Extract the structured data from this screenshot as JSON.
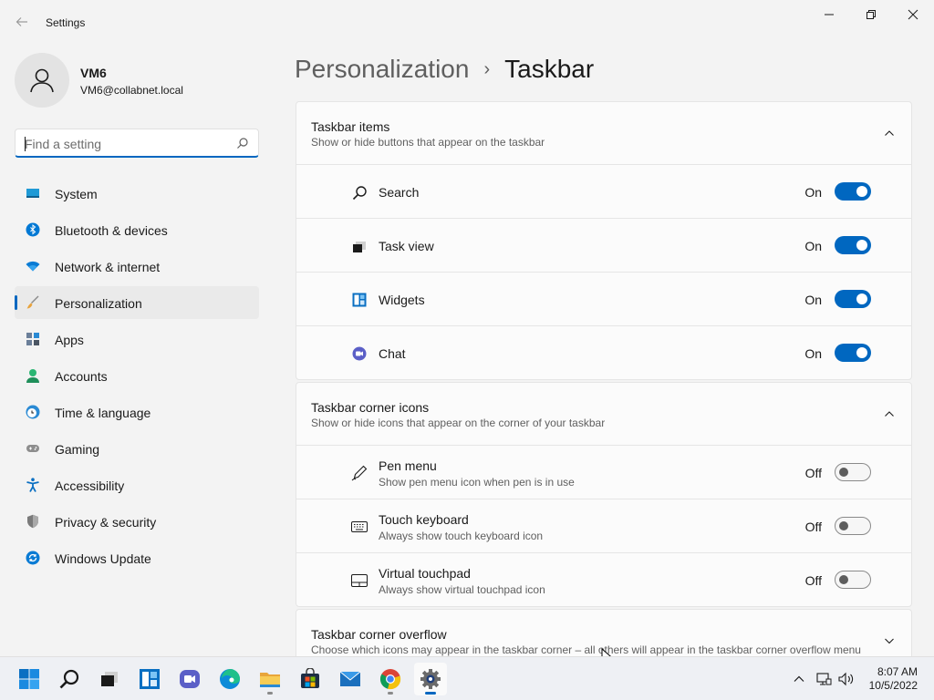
{
  "window": {
    "title": "Settings",
    "controls": {
      "minimize": "minimize-icon",
      "restore": "restore-icon",
      "close": "close-icon"
    }
  },
  "profile": {
    "name": "VM6",
    "email": "VM6@collabnet.local"
  },
  "search": {
    "placeholder": "Find a setting"
  },
  "sidebar": {
    "items": [
      {
        "label": "System",
        "icon": "system-icon"
      },
      {
        "label": "Bluetooth & devices",
        "icon": "bluetooth-icon"
      },
      {
        "label": "Network & internet",
        "icon": "wifi-icon"
      },
      {
        "label": "Personalization",
        "icon": "brush-icon",
        "active": true
      },
      {
        "label": "Apps",
        "icon": "apps-icon"
      },
      {
        "label": "Accounts",
        "icon": "accounts-icon"
      },
      {
        "label": "Time & language",
        "icon": "clock-globe-icon"
      },
      {
        "label": "Gaming",
        "icon": "gamepad-icon"
      },
      {
        "label": "Accessibility",
        "icon": "accessibility-icon"
      },
      {
        "label": "Privacy & security",
        "icon": "shield-icon"
      },
      {
        "label": "Windows Update",
        "icon": "windows-update-icon"
      }
    ]
  },
  "breadcrumb": {
    "parent": "Personalization",
    "separator": "›",
    "current": "Taskbar"
  },
  "sections": {
    "items": {
      "title": "Taskbar items",
      "subtitle": "Show or hide buttons that appear on the taskbar",
      "rows": [
        {
          "label": "Search",
          "state": "On",
          "icon": "search-icon"
        },
        {
          "label": "Task view",
          "state": "On",
          "icon": "task-view-icon"
        },
        {
          "label": "Widgets",
          "state": "On",
          "icon": "widgets-icon"
        },
        {
          "label": "Chat",
          "state": "On",
          "icon": "chat-icon"
        }
      ]
    },
    "corner": {
      "title": "Taskbar corner icons",
      "subtitle": "Show or hide icons that appear on the corner of your taskbar",
      "rows": [
        {
          "label": "Pen menu",
          "sub": "Show pen menu icon when pen is in use",
          "state": "Off",
          "icon": "pen-icon"
        },
        {
          "label": "Touch keyboard",
          "sub": "Always show touch keyboard icon",
          "state": "Off",
          "icon": "keyboard-icon"
        },
        {
          "label": "Virtual touchpad",
          "sub": "Always show virtual touchpad icon",
          "state": "Off",
          "icon": "touchpad-icon"
        }
      ]
    },
    "overflow": {
      "title": "Taskbar corner overflow",
      "subtitle": "Choose which icons may appear in the taskbar corner – all others will appear in the taskbar corner overflow menu"
    }
  },
  "taskbar": {
    "apps": [
      "start-icon",
      "search-icon",
      "task-view-icon",
      "widgets-icon",
      "chat-icon",
      "edge-icon",
      "file-explorer-icon",
      "store-icon",
      "mail-icon",
      "chrome-icon",
      "settings-icon"
    ],
    "clock": {
      "time": "8:07 AM",
      "date": "10/5/2022"
    }
  },
  "colors": {
    "accent": "#0067c0",
    "background": "#f3f3f3",
    "card": "#fbfbfb"
  }
}
